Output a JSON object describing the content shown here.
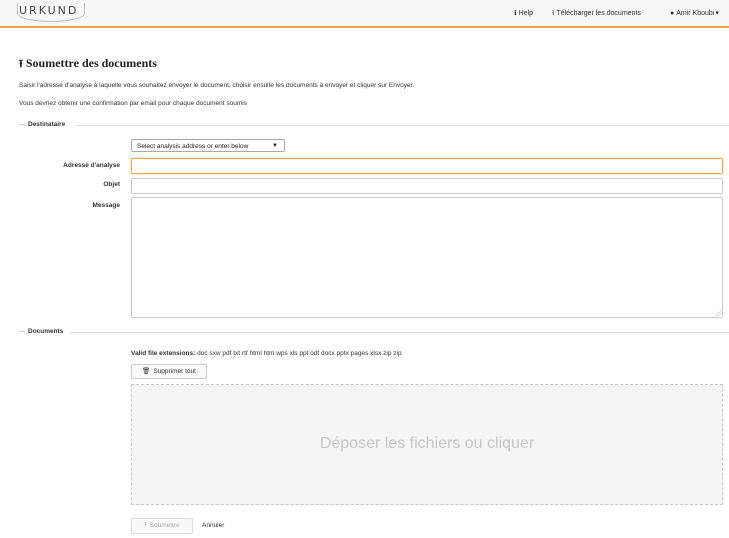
{
  "navbar": {
    "logo": "URKUND",
    "help": "Help",
    "download": "Télécharger les documents",
    "user": "Amir Kboubi"
  },
  "page": {
    "title": "Soumettre des documents",
    "intro1": "Saisir l'adresse d'analyse à laquelle vous souhaitez envoyer le document, choisir ensuite les documents à envoyer et cliquer sur Envoyer.",
    "intro2": "Vous devriez obtenir une confirmation par email pour chaque document soumis"
  },
  "recipient": {
    "legend": "Destinataire",
    "select_value": "Select analysis address or enter below",
    "address_label": "Adresse d'analyse",
    "address_value": "",
    "subject_label": "Objet",
    "subject_value": "",
    "message_label": "Message",
    "message_value": ""
  },
  "documents": {
    "legend": "Documents",
    "ext_label": "Valid file extensions:",
    "ext_list": "doc sxw pdf txt rtf html htm wps xls ppt odt docx pptx pages xlsx zip zip",
    "clear_all": "Supprimer tout",
    "dropzone_text": "Déposer les fichiers ou cliquer"
  },
  "actions": {
    "submit": "Soumettre",
    "cancel": "Annuler"
  },
  "colors": {
    "accent": "#f0a34a",
    "focus_border": "#f0ad4e"
  }
}
